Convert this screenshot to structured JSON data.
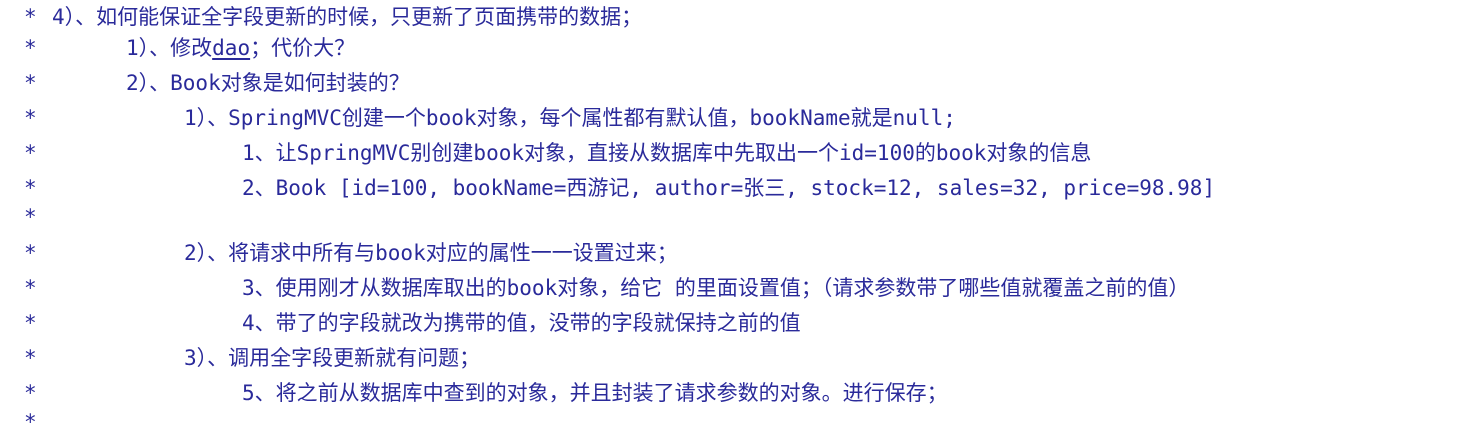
{
  "comment": {
    "lines": [
      {
        "star": "*",
        "text": "4）、如何能保证全字段更新的时候，只更新了页面携带的数据；"
      },
      {
        "star": "*",
        "text_before": "1）、修改",
        "text_link": "dao",
        "text_after": "；代价大？"
      },
      {
        "star": "*",
        "text": "2）、Book对象是如何封装的？"
      },
      {
        "star": "*",
        "text": "1）、SpringMVC创建一个book对象，每个属性都有默认值，bookName就是null;"
      },
      {
        "star": "*",
        "text": "1、让SpringMVC别创建book对象，直接从数据库中先取出一个id=100的book对象的信息"
      },
      {
        "star": "*",
        "text": "2、Book [id=100, bookName=西游记, author=张三, stock=12, sales=32, price=98.98]"
      },
      {
        "star": "*",
        "text": ""
      },
      {
        "star": "*",
        "text": "2）、将请求中所有与book对应的属性一一设置过来；"
      },
      {
        "star": "*",
        "text": "3、使用刚才从数据库取出的book对象，给它 的里面设置值；（请求参数带了哪些值就覆盖之前的值）"
      },
      {
        "star": "*",
        "text": "4、带了的字段就改为携带的值，没带的字段就保持之前的值"
      },
      {
        "star": "*",
        "text": "3）、调用全字段更新就有问题；"
      },
      {
        "star": "*",
        "text": "5、将之前从数据库中查到的对象，并且封装了请求参数的对象。进行保存；"
      },
      {
        "star": "*",
        "text": ""
      }
    ]
  },
  "colors": {
    "text": "#2a2a9a",
    "background": "#ffffff"
  }
}
